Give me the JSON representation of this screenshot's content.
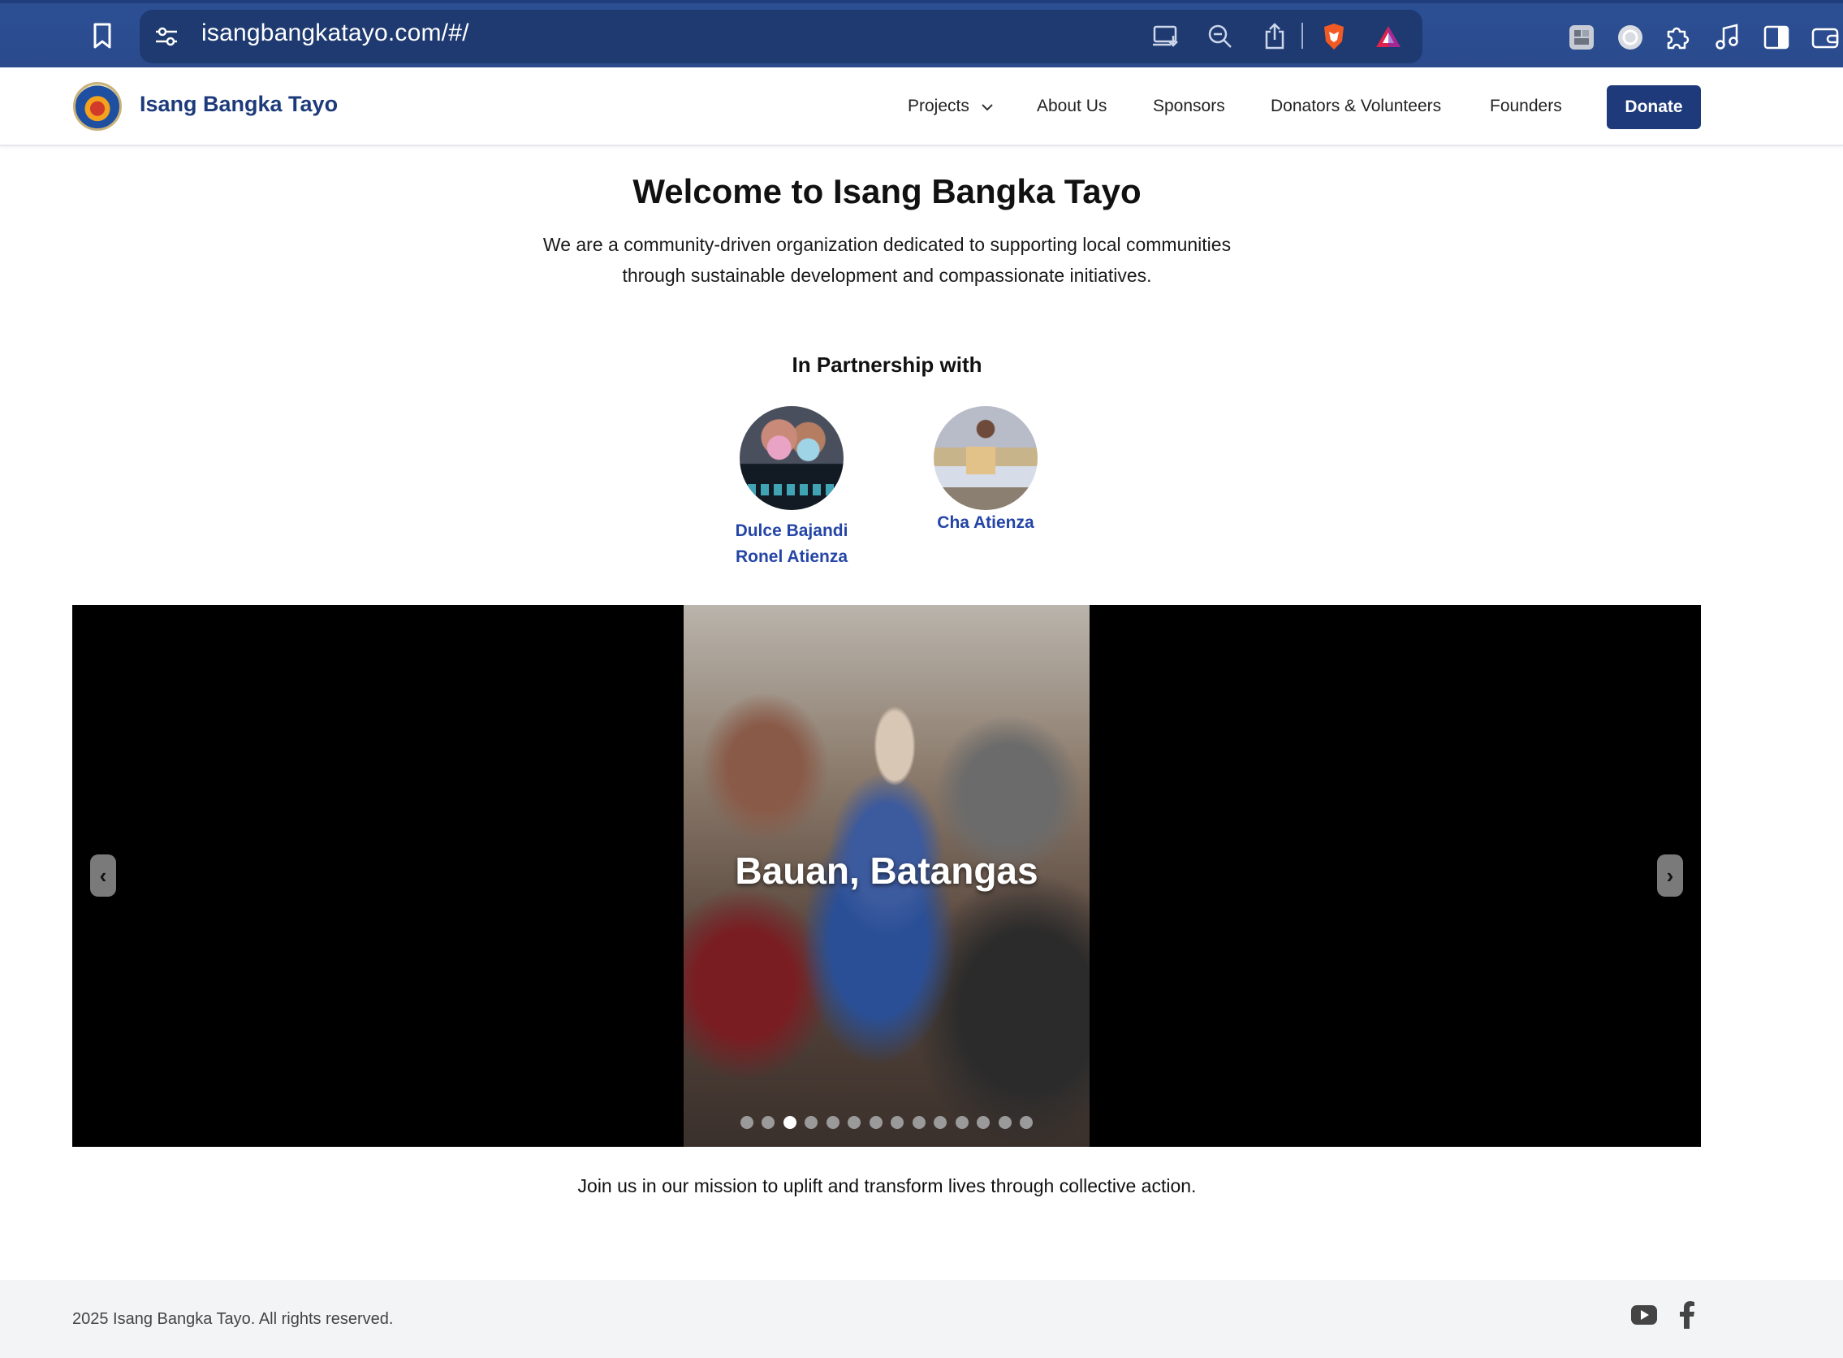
{
  "browser": {
    "url": "isangbangkatayo.com/#/"
  },
  "header": {
    "site_title": "Isang Bangka Tayo",
    "nav": {
      "projects": "Projects",
      "about": "About Us",
      "sponsors": "Sponsors",
      "donators": "Donators & Volunteers",
      "founders": "Founders"
    },
    "donate": "Donate"
  },
  "main": {
    "title": "Welcome to Isang Bangka Tayo",
    "subtitle": "We are a community-driven organization dedicated to supporting local communities through sustainable development and compassionate initiatives.",
    "partnership_heading": "In Partnership with",
    "partners": [
      {
        "name_line1": "Dulce Bajandi",
        "name_line2": "Ronel Atienza"
      },
      {
        "name_line1": "Cha Atienza"
      }
    ],
    "carousel": {
      "caption": "Bauan, Batangas",
      "prev_label": "‹",
      "next_label": "›",
      "slide_count": 14,
      "active_index": 2
    },
    "mission": "Join us in our mission to uplift and transform lives through collective action."
  },
  "footer": {
    "copyright": "2025 Isang Bangka Tayo. All rights reserved.",
    "social_icons": [
      "youtube-icon",
      "facebook-icon"
    ]
  },
  "colors": {
    "browser_bar": "#2a4a8c",
    "brand_blue": "#1e3a7a",
    "partner_link": "#2445a6",
    "footer_bg": "#f3f4f6"
  }
}
